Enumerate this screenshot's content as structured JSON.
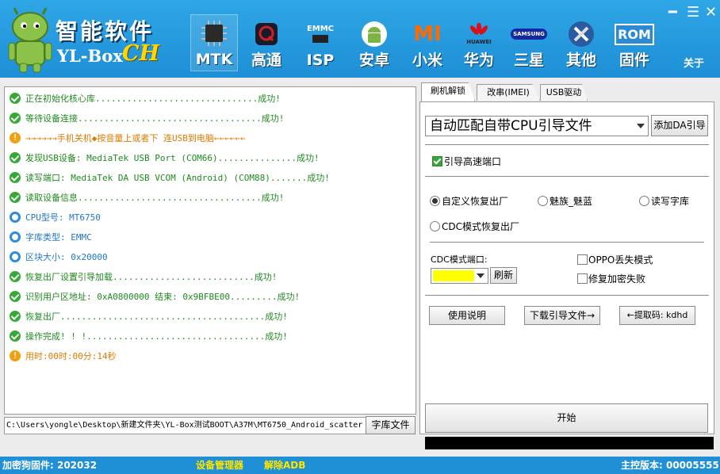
{
  "header": {
    "logo_title": "智能软件",
    "logo_sub": "YL-Box",
    "logo_ch": "CH",
    "window_controls": [
      "━",
      "☰",
      "✕"
    ],
    "about": "关于",
    "nav": [
      {
        "label": "MTK",
        "icon": "chip-icon",
        "badge": "MTK"
      },
      {
        "label": "高通",
        "icon": "qualcomm-icon",
        "badge": ""
      },
      {
        "label": "ISP",
        "icon": "emmc-icon",
        "badge": "EMMC"
      },
      {
        "label": "安卓",
        "icon": "android-icon",
        "badge": ""
      },
      {
        "label": "小米",
        "icon": "mi-icon",
        "badge": "MI"
      },
      {
        "label": "华为",
        "icon": "huawei-icon",
        "badge": "HUAWEI"
      },
      {
        "label": "三星",
        "icon": "samsung-icon",
        "badge": "SAMSUNG"
      },
      {
        "label": "其他",
        "icon": "tools-icon",
        "badge": ""
      },
      {
        "label": "固件",
        "icon": "rom-icon",
        "badge": "ROM"
      }
    ]
  },
  "log": [
    {
      "type": "ok",
      "color": "green",
      "text": "正在初始化核心库...............................成功!"
    },
    {
      "type": "ok",
      "color": "green",
      "text": "等待设备连接...................................成功!"
    },
    {
      "type": "warn",
      "color": "orange",
      "text": "→→→→→→手机关机◆按音量上或者下  连USB到电脑←←←←←←"
    },
    {
      "type": "ok",
      "color": "green",
      "text": "发现USB设备: MediaTek USB Port (COM66)...............成功!"
    },
    {
      "type": "ok",
      "color": "green",
      "text": "读写端口: MediaTek DA USB VCOM (Android) (COM88).......成功!"
    },
    {
      "type": "ok",
      "color": "green",
      "text": "读取设备信息...................................成功!"
    },
    {
      "type": "info",
      "color": "blue",
      "text": "CPU型号: MT6750"
    },
    {
      "type": "info",
      "color": "blue",
      "text": "字库类型: EMMC"
    },
    {
      "type": "info",
      "color": "blue",
      "text": "区块大小: 0x20000"
    },
    {
      "type": "ok",
      "color": "green",
      "text": "恢复出厂设置引导加载...........................成功!"
    },
    {
      "type": "ok",
      "color": "green",
      "text": "识别用户区地址: 0xA0800000     结束: 0x9BFBE00.........成功!"
    },
    {
      "type": "ok",
      "color": "green",
      "text": "恢复出厂.......................................成功!"
    },
    {
      "type": "ok",
      "color": "green",
      "text": "操作完成! ! !..................................成功!"
    },
    {
      "type": "warn",
      "color": "orange",
      "text": "用时:00时:00分:14秒"
    }
  ],
  "path_value": "C:\\Users\\yongle\\Desktop\\新建文件夹\\YL-Box测试BOOT\\A37M\\MT6750_Android_scatter",
  "font_file_button": "字库文件",
  "tabs": [
    "刷机解锁",
    "改串(IMEI)",
    "USB驱动"
  ],
  "right": {
    "loader_select": "自动匹配自带CPU引导文件",
    "add_da_button": "添加DA引导",
    "high_speed_port": "引导高速端口",
    "radios": [
      "自定义恢复出厂",
      "魅族_魅蓝",
      "读写字库",
      "CDC模式恢复出厂"
    ],
    "cdc_port_label": "CDC模式端口:",
    "port_color": "#ffff00",
    "refresh_button": "刷新",
    "oppo_lost_mode": "OPPO丢失模式",
    "fix_encrypt": "修复加密失败",
    "usage_button": "使用说明",
    "download_button": "下载引导文件→",
    "extract_button": "←提取码: kdhd",
    "start_button": "开始"
  },
  "status": {
    "dongle": "加密狗固件: 202032",
    "device_manager": "设备管理器",
    "remove_adb": "解除ADB",
    "version": "主控版本: 00005555"
  },
  "colors": {
    "header_blue": "#1e8fd6",
    "accent_yellow": "#ffd800",
    "ok_green": "#1f8a1f",
    "warn_orange": "#e07a00",
    "info_blue": "#2277cc"
  }
}
